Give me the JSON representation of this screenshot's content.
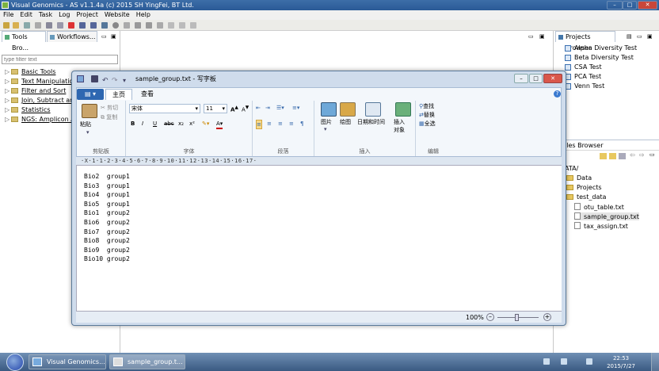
{
  "app": {
    "title": "Visual Genomics - AS v1.1.4a (c) 2015 SH YingFei, BT Ltd."
  },
  "menu": [
    "File",
    "Edit",
    "Task",
    "Log",
    "Project",
    "Website",
    "Help"
  ],
  "left_panel": {
    "tabs": [
      "Tools Bro...",
      "Workflows..."
    ],
    "filter_placeholder": "type filter text",
    "tree": [
      "Basic Tools",
      "Text Manipulation",
      "Filter and Sort",
      "Join, Subtract and",
      "Statistics",
      "NGS: Amplicon An"
    ]
  },
  "projects_panel": {
    "title": "Projects Browser",
    "items": [
      "Alpha Diversity Test",
      "Beta Diversity Test",
      "CSA Test",
      "PCA Test",
      "Venn Test"
    ]
  },
  "files_panel": {
    "title": "iles Browser",
    "root": "ATA/",
    "items": [
      "Data",
      "Projects",
      "test_data"
    ],
    "files": [
      "otu_table.txt",
      "sample_group.txt",
      "tax_assign.txt"
    ]
  },
  "wordpad": {
    "title": "sample_group.txt - 写字板",
    "tabs": [
      "主页",
      "查看"
    ],
    "clipboard": {
      "paste": "粘贴",
      "cut": "剪切",
      "copy": "复制",
      "label": "剪贴板"
    },
    "font": {
      "name": "宋体",
      "size": "11",
      "label": "字体"
    },
    "paragraph": {
      "label": "段落"
    },
    "insert": {
      "picture": "图片",
      "paint": "绘图",
      "datetime": "日期和时间",
      "object": "插入\n对象",
      "label": "插入"
    },
    "editing": {
      "find": "查找",
      "replace": "替换",
      "select_all": "全选",
      "label": "编辑"
    },
    "ruler": "·X·1·1·2·3·4·5·6·7·8·9·10·11·12·13·14·15·16·17·",
    "lines": [
      "Bio2  group1",
      "Bio3  group1",
      "Bio4  group1",
      "Bio5  group1",
      "Bio1  group2",
      "Bio6  group2",
      "Bio7  group2",
      "Bio8  group2",
      "Bio9  group2",
      "Bio10 group2"
    ],
    "zoom": "100%"
  },
  "taskbar": {
    "tasks": [
      "Visual Genomics...",
      "sample_group.t..."
    ],
    "time": "22:53",
    "date": "2015/7/27"
  }
}
